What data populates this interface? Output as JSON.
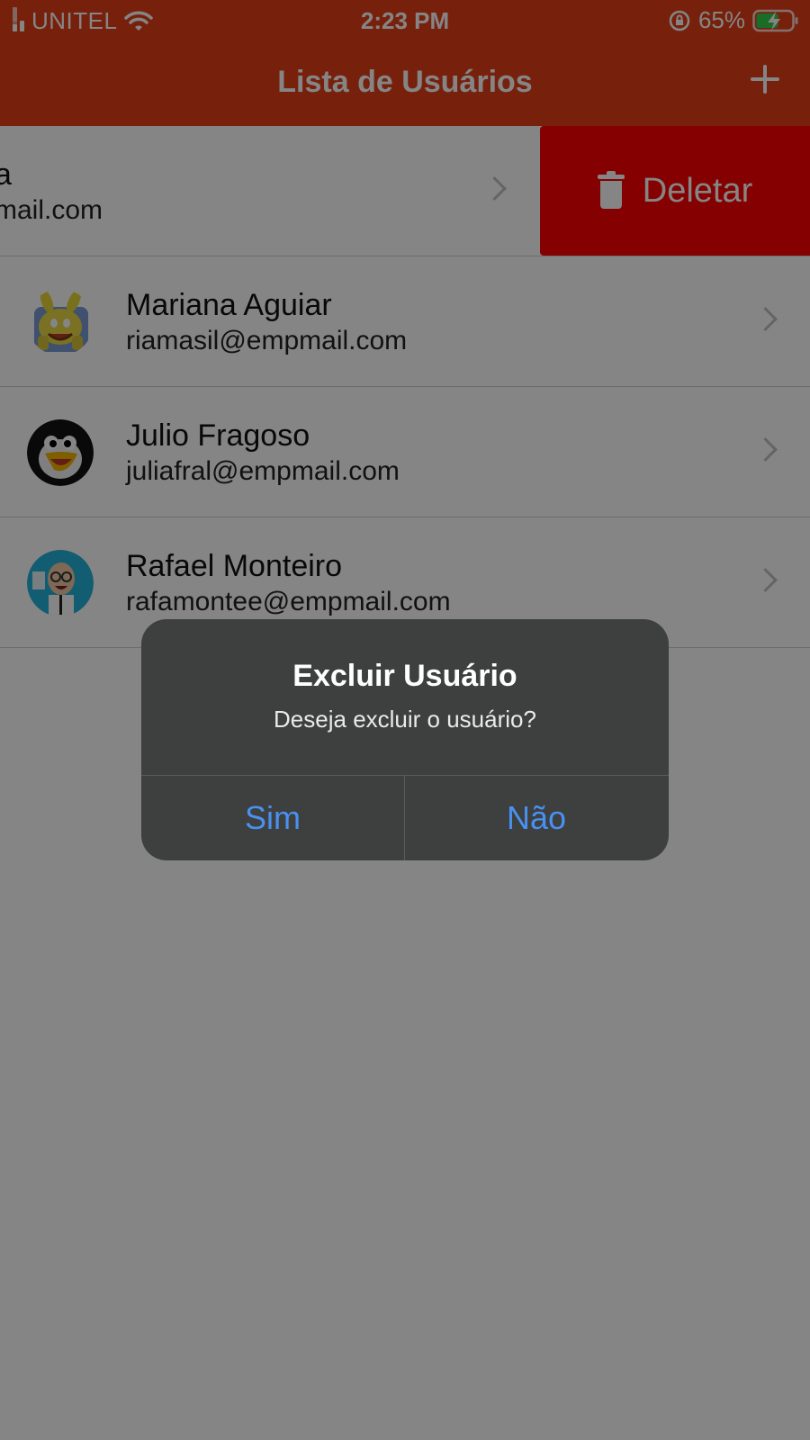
{
  "status_bar": {
    "carrier": "UNITEL",
    "time": "2:23 PM",
    "battery": "65%"
  },
  "nav": {
    "title": "Lista de Usuários",
    "add_icon": "plus-icon"
  },
  "users": [
    {
      "name": "a",
      "email": "mail.com",
      "avatar": "hidden-avatar"
    },
    {
      "name": "Mariana Aguiar",
      "email": "riamasil@empmail.com",
      "avatar": "rabbit-avatar"
    },
    {
      "name": "Julio Fragoso",
      "email": "juliafral@empmail.com",
      "avatar": "penguin-avatar"
    },
    {
      "name": "Rafael Monteiro",
      "email": "rafamontee@empmail.com",
      "avatar": "professor-avatar"
    }
  ],
  "swipe_action": {
    "label": "Deletar",
    "icon": "trash-icon",
    "color": "#ff0000"
  },
  "alert": {
    "title": "Excluir Usuário",
    "message": "Deseja excluir o usuário?",
    "confirm_label": "Sim",
    "cancel_label": "Não"
  },
  "colors": {
    "header": "#e5401a",
    "alert_bg": "#3e3f3f",
    "alert_button": "#4a90f0"
  }
}
